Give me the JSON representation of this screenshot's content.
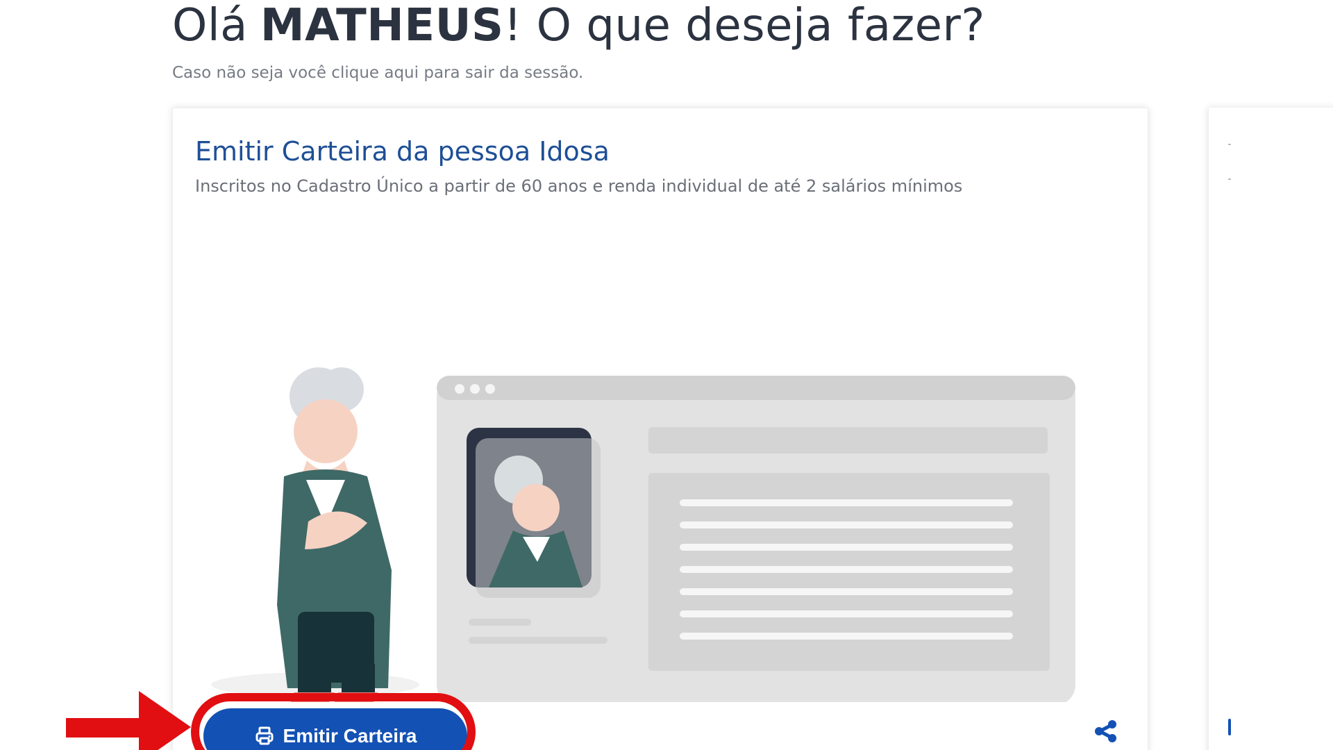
{
  "header": {
    "greeting_prefix": "Olá",
    "user_name": "MATHEUS",
    "greeting_suffix": "! O que deseja fazer?",
    "logout_prefix": "Caso não seja você",
    "logout_link": "clique aqui",
    "logout_suffix": "para sair da sessão."
  },
  "card": {
    "title": "Emitir Carteira da pessoa Idosa",
    "subtitle": "Inscritos no Cadastro Único a partir de 60 anos e renda individual de até 2 salários mínimos",
    "primary_button_label": "Emitir Carteira",
    "primary_button_icon": "printer-icon",
    "share_icon": "share-icon"
  },
  "colors": {
    "background": "#ffffff",
    "heading_text": "#2c3340",
    "muted_text": "#767b84",
    "card_title": "#1e4f96",
    "primary_button": "#1351b4",
    "annotation_red": "#e10f12"
  }
}
